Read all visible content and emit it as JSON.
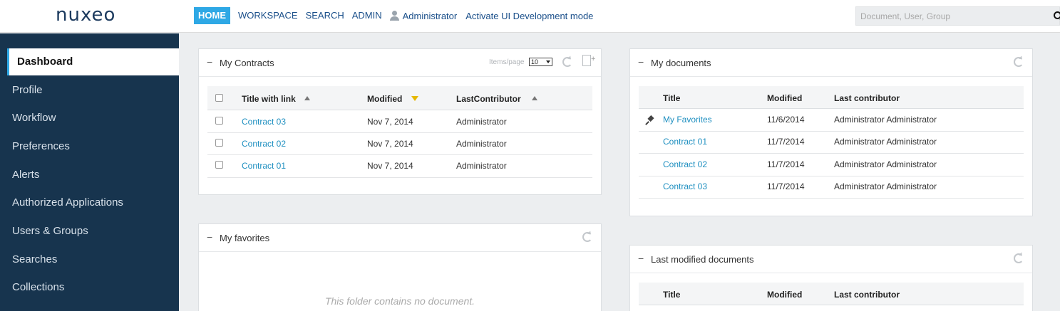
{
  "header": {
    "logo": "nuxeo",
    "nav": [
      "HOME",
      "WORKSPACE",
      "SEARCH",
      "ADMIN"
    ],
    "user": "Administrator",
    "devmode": "Activate UI Development mode",
    "search_placeholder": "Document, User, Group"
  },
  "sidebar": {
    "items": [
      "Dashboard",
      "Profile",
      "Workflow",
      "Preferences",
      "Alerts",
      "Authorized Applications",
      "Users & Groups",
      "Searches",
      "Collections"
    ]
  },
  "contracts": {
    "title": "My Contracts",
    "items_per_page_label": "Items/page",
    "items_per_page": "10",
    "columns": [
      "Title with link",
      "Modified",
      "LastContributor"
    ],
    "rows": [
      {
        "title": "Contract 03",
        "modified": "Nov 7, 2014",
        "contributor": "Administrator"
      },
      {
        "title": "Contract 02",
        "modified": "Nov 7, 2014",
        "contributor": "Administrator"
      },
      {
        "title": "Contract 01",
        "modified": "Nov 7, 2014",
        "contributor": "Administrator"
      }
    ]
  },
  "favorites": {
    "title": "My favorites",
    "empty_message": "This folder contains no document."
  },
  "documents": {
    "title": "My documents",
    "columns": [
      "Title",
      "Modified",
      "Last contributor"
    ],
    "rows": [
      {
        "title": "My Favorites",
        "modified": "11/6/2014",
        "contributor": "Administrator Administrator"
      },
      {
        "title": "Contract 01",
        "modified": "11/7/2014",
        "contributor": "Administrator Administrator"
      },
      {
        "title": "Contract 02",
        "modified": "11/7/2014",
        "contributor": "Administrator Administrator"
      },
      {
        "title": "Contract 03",
        "modified": "11/7/2014",
        "contributor": "Administrator Administrator"
      }
    ]
  },
  "last_modified": {
    "title": "Last modified documents",
    "columns": [
      "Title",
      "Modified",
      "Last contributor"
    ]
  },
  "colors": {
    "accent": "#2ea8e5",
    "sidebar_bg": "#17344e",
    "link": "#1e8fc0"
  }
}
